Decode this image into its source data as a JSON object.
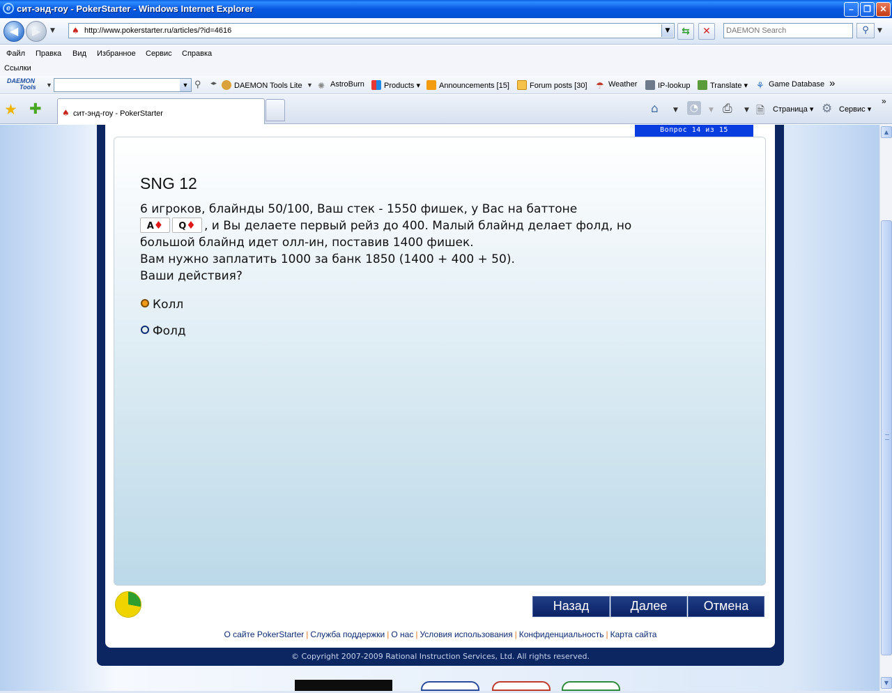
{
  "window": {
    "title": "сит-энд-гоу - PokerStarter - Windows Internet Explorer",
    "minimize": "–",
    "maximize": "❐",
    "close": "✕"
  },
  "address": {
    "url": "http://www.pokerstarter.ru/articles/?id=4616",
    "search_placeholder": "DAEMON Search"
  },
  "menu": [
    "Файл",
    "Правка",
    "Вид",
    "Избранное",
    "Сервис",
    "Справка"
  ],
  "links_label": "Ссылки",
  "daemon_toolbar": {
    "logo_line1": "DAEMON",
    "logo_line2": "Tools",
    "items": [
      "DAEMON Tools Lite",
      "AstroBurn",
      "Products",
      "Announcements [15]",
      "Forum posts [30]",
      "Weather",
      "IP-lookup",
      "Translate",
      "Game Database"
    ],
    "more": "»"
  },
  "tabs": {
    "active_label": "сит-энд-гоу - PokerStarter"
  },
  "commandbar": {
    "page": "Страница",
    "tools": "Сервис"
  },
  "quiz": {
    "progress": "Вопрос 14 из 15",
    "title": "SNG 12",
    "line1": "6 игроков, блайнды 50/100, Ваш стек - 1550 фишек, у Вас на баттоне",
    "cards": [
      {
        "rank": "A",
        "suit": "♦"
      },
      {
        "rank": "Q",
        "suit": "♦"
      }
    ],
    "line2": ", и Вы делаете первый рейз до 400. Малый блайнд делает фолд, но",
    "line3": "большой блайнд идет олл-ин, поставив 1400 фишек.",
    "line4": "Вам нужно заплатить 1000 за банк 1850 (1400 + 400 + 50).",
    "line5": "Ваши действия?",
    "options": [
      {
        "label": "Колл",
        "selected": true
      },
      {
        "label": "Фолд",
        "selected": false
      }
    ],
    "buttons": {
      "back": "Назад",
      "next": "Далее",
      "cancel": "Отмена"
    },
    "progress_fraction": 0.28
  },
  "footer": {
    "links": [
      "О сайте PokerStarter",
      "Служба поддержки",
      "О нас",
      "Условия использования",
      "Конфиденциальность",
      "Карта сайта"
    ],
    "copyright": "© Copyright 2007-2009 Rational Instruction Services, Ltd. All rights reserved."
  }
}
